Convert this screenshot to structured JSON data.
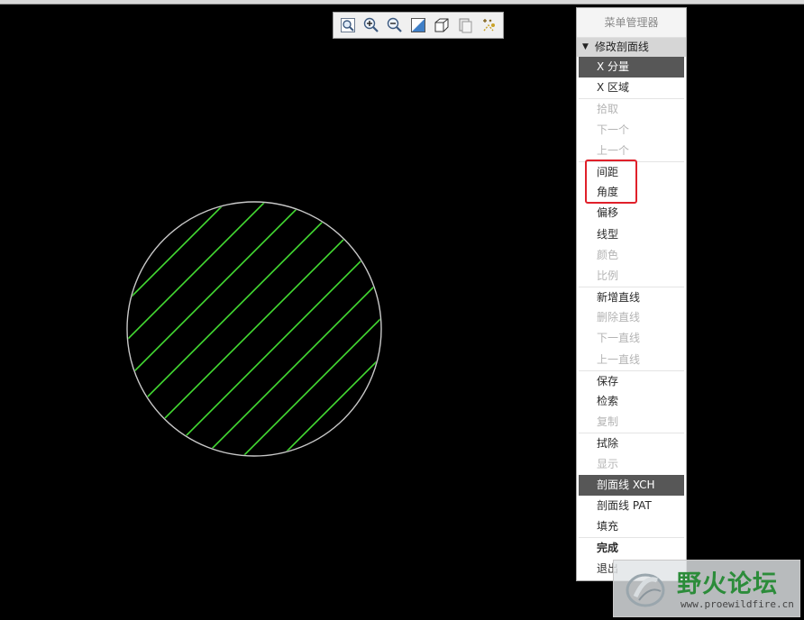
{
  "toolbar": {
    "icons": [
      "zoom-fit-icon",
      "zoom-in-icon",
      "zoom-out-icon",
      "repaint-icon",
      "view-orient-icon",
      "saved-views-icon",
      "hide-datum-icon"
    ]
  },
  "canvas": {
    "circle_stroke": "#c8c8c8",
    "hatch_color": "#44dd33",
    "background": "#000000"
  },
  "menu": {
    "title": "菜单管理器",
    "header": "修改剖面线",
    "groups": [
      [
        {
          "label": "X 分量",
          "state": "selected"
        },
        {
          "label": "X 区域",
          "state": "enabled"
        }
      ],
      [
        {
          "label": "拾取",
          "state": "disabled"
        },
        {
          "label": "下一个",
          "state": "disabled"
        },
        {
          "label": "上一个",
          "state": "disabled"
        }
      ],
      [
        {
          "label": "间距",
          "state": "enabled"
        },
        {
          "label": "角度",
          "state": "enabled"
        },
        {
          "label": "偏移",
          "state": "enabled"
        },
        {
          "label": "线型",
          "state": "enabled"
        },
        {
          "label": "颜色",
          "state": "disabled"
        },
        {
          "label": "比例",
          "state": "disabled"
        }
      ],
      [
        {
          "label": "新增直线",
          "state": "enabled"
        },
        {
          "label": "删除直线",
          "state": "disabled"
        },
        {
          "label": "下一直线",
          "state": "disabled"
        },
        {
          "label": "上一直线",
          "state": "disabled"
        }
      ],
      [
        {
          "label": "保存",
          "state": "enabled"
        },
        {
          "label": "检索",
          "state": "enabled"
        },
        {
          "label": "复制",
          "state": "disabled"
        }
      ],
      [
        {
          "label": "拭除",
          "state": "enabled"
        },
        {
          "label": "显示",
          "state": "disabled"
        }
      ],
      [
        {
          "label": "剖面线 XCH",
          "state": "selected"
        },
        {
          "label": "剖面线 PAT",
          "state": "enabled"
        },
        {
          "label": "填充",
          "state": "enabled"
        }
      ],
      [
        {
          "label": "完成",
          "state": "enabled"
        },
        {
          "label": "退出",
          "state": "enabled"
        }
      ]
    ]
  },
  "watermark": {
    "title": "野火论坛",
    "url": "www.proewildfire.cn"
  }
}
